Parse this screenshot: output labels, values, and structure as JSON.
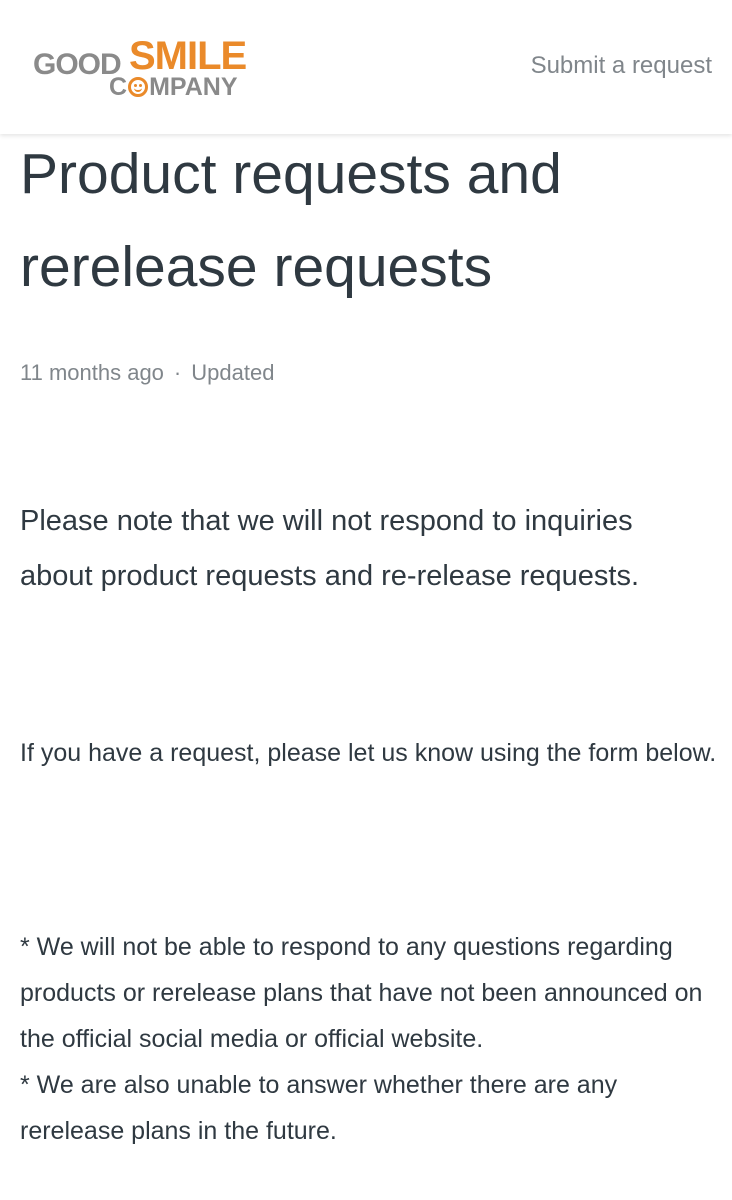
{
  "header": {
    "logo_good": "GOOD",
    "logo_smile": "SMILE",
    "logo_company_c": "C",
    "logo_company_rest": "MPANY",
    "submit_link": "Submit a request"
  },
  "article": {
    "title": "Product requests and rerelease requests",
    "meta_time": "11 months ago",
    "meta_separator": "·",
    "meta_status": "Updated",
    "lead": "Please note that we will not respond to inquiries about product requests and re-release requests.",
    "form_note": "If you have a request, please let us know using the form below.",
    "note_1": "* We will not be able to respond to any questions regarding products or rerelease plans that have not been announced on the official social media or official website.",
    "note_2": "* We are also unable to answer whether there are any rerelease plans in the future."
  },
  "colors": {
    "brand_orange": "#ea8a2a",
    "brand_gray": "#8a8a8a",
    "text_primary": "#2f3941",
    "text_muted": "#80868b"
  }
}
